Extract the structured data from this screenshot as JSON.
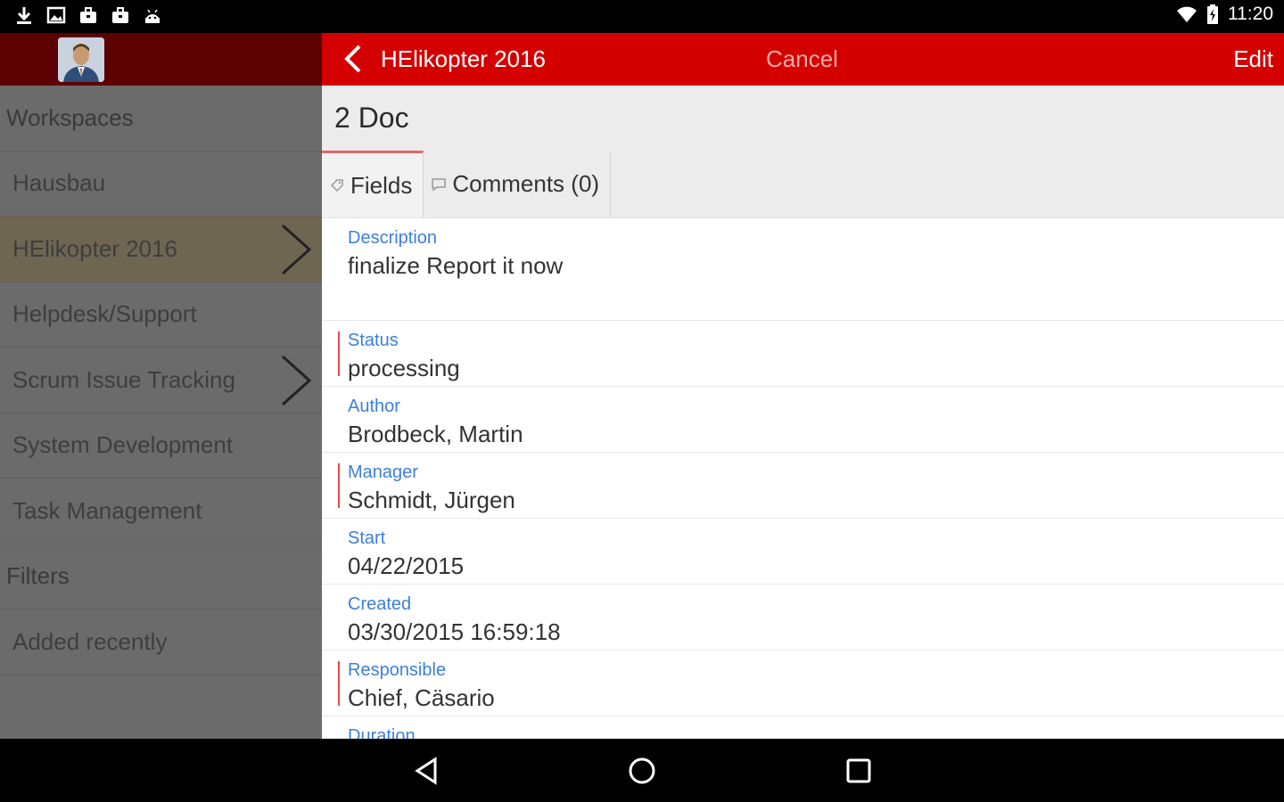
{
  "status_bar": {
    "time": "11:20",
    "left_icons": [
      "download-icon",
      "image-icon",
      "briefcase-icon",
      "briefcase-icon",
      "android-icon"
    ],
    "right_icons": [
      "wifi-icon",
      "battery-icon"
    ]
  },
  "sidebar": {
    "sections": [
      {
        "label": "Workspaces",
        "type": "section"
      },
      {
        "label": "Hausbau",
        "type": "item"
      },
      {
        "label": "HElikopter 2016",
        "type": "item",
        "active": true,
        "chevron": true
      },
      {
        "label": "Helpdesk/Support",
        "type": "item"
      },
      {
        "label": "Scrum Issue Tracking",
        "type": "item",
        "chevron": true
      },
      {
        "label": "System Development",
        "type": "item"
      },
      {
        "label": "Task Management",
        "type": "item"
      },
      {
        "label": "Filters",
        "type": "section"
      },
      {
        "label": "Added recently",
        "type": "item"
      }
    ]
  },
  "toolbar": {
    "title": "HElikopter 2016",
    "cancel_label": "Cancel",
    "edit_label": "Edit"
  },
  "document": {
    "title": "2 Doc"
  },
  "tabs": [
    {
      "label": "Fields",
      "icon": "tag-icon",
      "active": true
    },
    {
      "label": "Comments (0)",
      "icon": "comment-icon",
      "active": false
    }
  ],
  "fields": [
    {
      "label": "Description",
      "value": "finalize Report it now",
      "required": false
    },
    {
      "label": "Status",
      "value": "processing",
      "required": true
    },
    {
      "label": "Author",
      "value": "Brodbeck, Martin",
      "required": false
    },
    {
      "label": "Manager",
      "value": "Schmidt, Jürgen",
      "required": true
    },
    {
      "label": "Start",
      "value": "04/22/2015",
      "required": false
    },
    {
      "label": "Created",
      "value": "03/30/2015 16:59:18",
      "required": false
    },
    {
      "label": "Responsible",
      "value": "Chief, Cäsario",
      "required": true
    },
    {
      "label": "Duration",
      "value": "",
      "required": false
    }
  ],
  "colors": {
    "brand_red": "#d40000",
    "sidebar_header": "#5c0000",
    "sidebar_bg": "#6b6b6b",
    "active_item": "#6f6652",
    "label_blue": "#3d7fd6",
    "required_bar": "#e04848"
  }
}
